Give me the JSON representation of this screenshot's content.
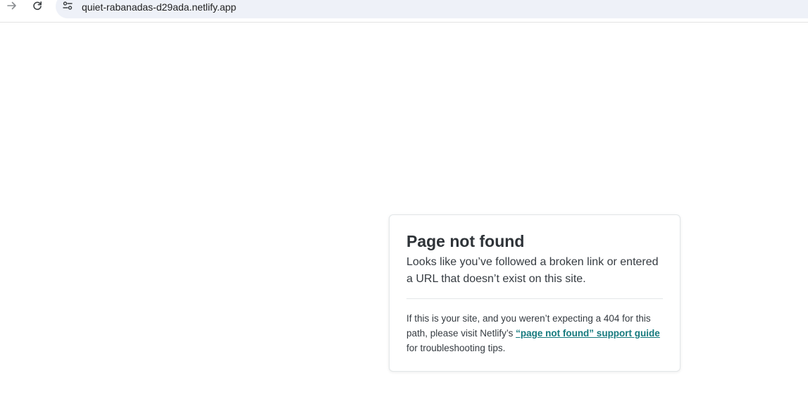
{
  "browser": {
    "url": "quiet-rabanadas-d29ada.netlify.app",
    "icons": {
      "forward": "arrow-right-icon",
      "reload": "reload-icon",
      "site_info": "tune-icon"
    }
  },
  "card": {
    "title": "Page not found",
    "lead": "Looks like you’ve followed a broken link or entered a URL that doesn’t exist on this site.",
    "note_before": "If this is your site, and you weren’t expecting a 404 for this path, please visit Netlify’s ",
    "link_text": "“page not found” support guide",
    "note_after": " for troubleshooting tips."
  },
  "colors": {
    "link": "#167a7e",
    "omnibox": "#eef1f8",
    "text": "#2e3338"
  }
}
